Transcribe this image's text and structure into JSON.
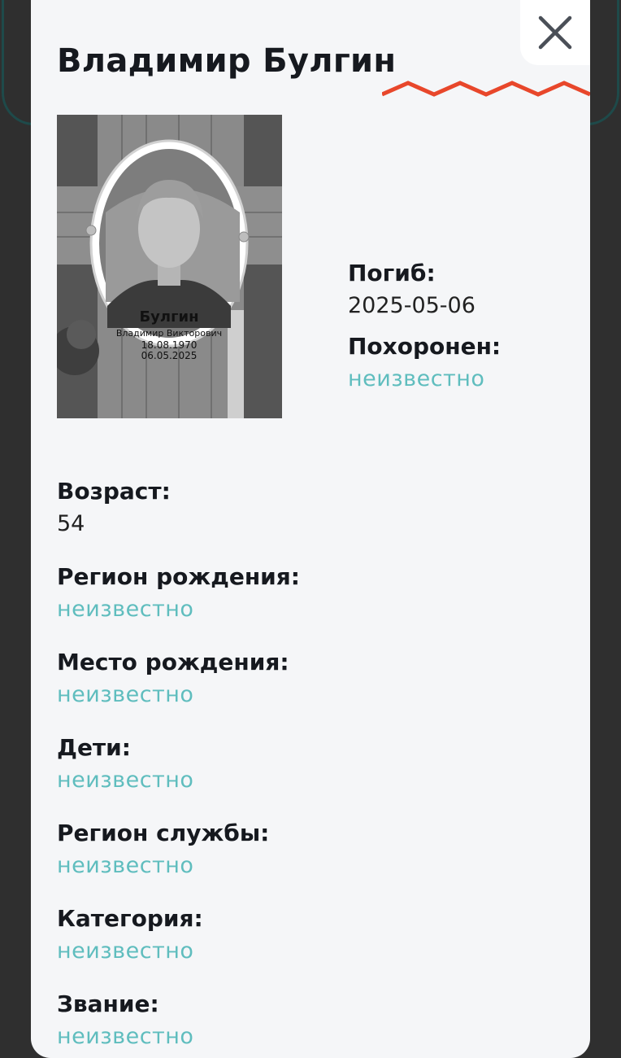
{
  "person": {
    "name": "Владимир Булгин"
  },
  "photo": {
    "plaque_surname": "Булгин",
    "plaque_name": "Владимир Викторович",
    "plaque_birth": "18.08.1970",
    "plaque_death": "06.05.2025"
  },
  "death": {
    "label": "Погиб:",
    "value": "2025-05-06"
  },
  "burial": {
    "label": "Похоронен:",
    "value": "неизвестно"
  },
  "fields": [
    {
      "label": "Возраст:",
      "value": "54"
    },
    {
      "label": "Регион рождения:",
      "value": "неизвестно"
    },
    {
      "label": "Место рождения:",
      "value": "неизвестно"
    },
    {
      "label": "Дети:",
      "value": "неизвестно"
    },
    {
      "label": "Регион службы:",
      "value": "неизвестно"
    },
    {
      "label": "Категория:",
      "value": "неизвестно"
    },
    {
      "label": "Звание:",
      "value": "неизвестно"
    }
  ],
  "colors": {
    "accent": "#e8472b",
    "unknown_text": "#5fbdbe",
    "modal_bg": "#f5f6f8"
  },
  "icons": {
    "close": "close-icon"
  }
}
